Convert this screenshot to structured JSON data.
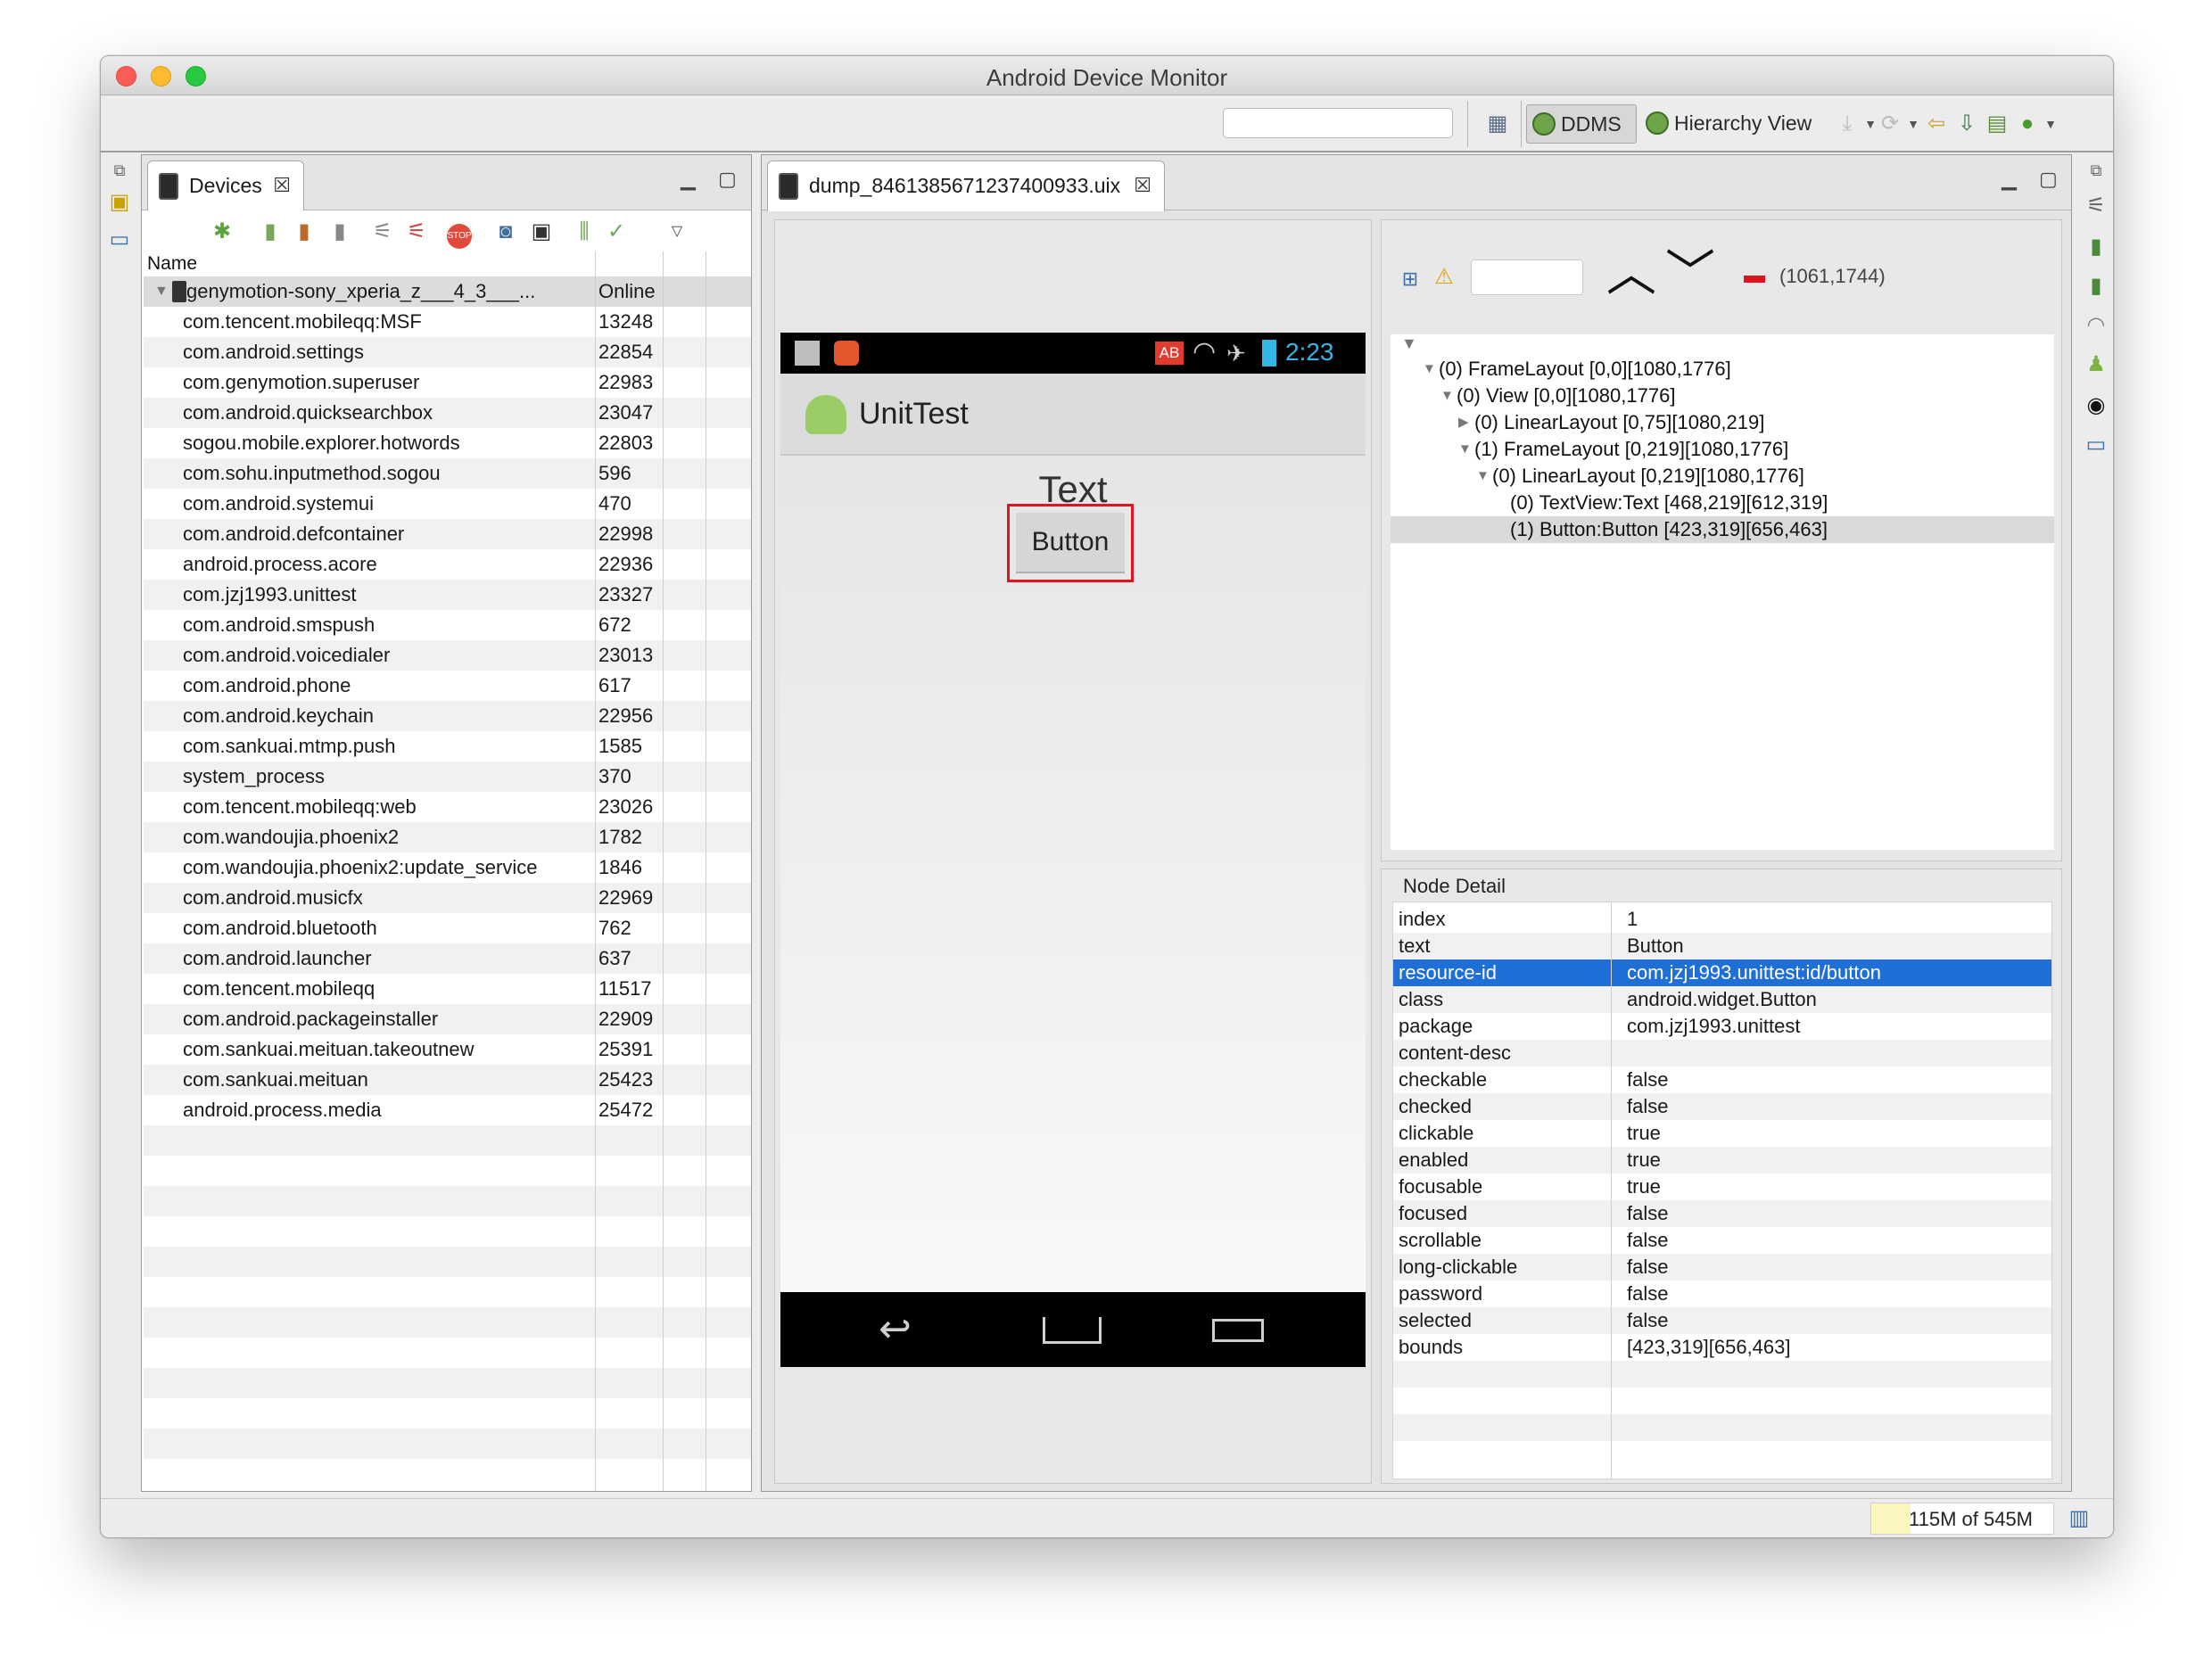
{
  "window": {
    "title": "Android Device Monitor"
  },
  "toolbar": {
    "quick_access_value": "",
    "perspectives": [
      {
        "label": "DDMS",
        "icon": "ddms-icon"
      },
      {
        "label": "Hierarchy View",
        "icon": "hierarchy-view-icon"
      }
    ]
  },
  "devices_view": {
    "tab_label": "Devices",
    "column_name": "Name",
    "device": {
      "name": "genymotion-sony_xperia_z___4_3___...",
      "status": "Online"
    },
    "processes": [
      {
        "name": "com.tencent.mobileqq:MSF",
        "pid": "13248"
      },
      {
        "name": "com.android.settings",
        "pid": "22854"
      },
      {
        "name": "com.genymotion.superuser",
        "pid": "22983"
      },
      {
        "name": "com.android.quicksearchbox",
        "pid": "23047"
      },
      {
        "name": "sogou.mobile.explorer.hotwords",
        "pid": "22803"
      },
      {
        "name": "com.sohu.inputmethod.sogou",
        "pid": "596"
      },
      {
        "name": "com.android.systemui",
        "pid": "470"
      },
      {
        "name": "com.android.defcontainer",
        "pid": "22998"
      },
      {
        "name": "android.process.acore",
        "pid": "22936"
      },
      {
        "name": "com.jzj1993.unittest",
        "pid": "23327"
      },
      {
        "name": "com.android.smspush",
        "pid": "672"
      },
      {
        "name": "com.android.voicedialer",
        "pid": "23013"
      },
      {
        "name": "com.android.phone",
        "pid": "617"
      },
      {
        "name": "com.android.keychain",
        "pid": "22956"
      },
      {
        "name": "com.sankuai.mtmp.push",
        "pid": "1585"
      },
      {
        "name": "system_process",
        "pid": "370"
      },
      {
        "name": "com.tencent.mobileqq:web",
        "pid": "23026"
      },
      {
        "name": "com.wandoujia.phoenix2",
        "pid": "1782"
      },
      {
        "name": "com.wandoujia.phoenix2:update_service",
        "pid": "1846"
      },
      {
        "name": "com.android.musicfx",
        "pid": "22969"
      },
      {
        "name": "com.android.bluetooth",
        "pid": "762"
      },
      {
        "name": "com.android.launcher",
        "pid": "637"
      },
      {
        "name": "com.tencent.mobileqq",
        "pid": "11517"
      },
      {
        "name": "com.android.packageinstaller",
        "pid": "22909"
      },
      {
        "name": "com.sankuai.meituan.takeoutnew",
        "pid": "25391"
      },
      {
        "name": "com.sankuai.meituan",
        "pid": "25423"
      },
      {
        "name": "android.process.media",
        "pid": "25472"
      }
    ]
  },
  "dump_view": {
    "tab_label": "dump_8461385671237400933.uix",
    "phone": {
      "status_time": "2:23",
      "status_badge": "AB",
      "action_bar_title": "UnitTest",
      "text_view": "Text",
      "button_label": "Button"
    },
    "search_value": "",
    "coords": "(1061,1744)",
    "tree": [
      {
        "label": "(0) FrameLayout [0,0][1080,1776]",
        "depth": 1,
        "toggle": "▼"
      },
      {
        "label": "(0) View [0,0][1080,1776]",
        "depth": 2,
        "toggle": "▼"
      },
      {
        "label": "(0) LinearLayout [0,75][1080,219]",
        "depth": 3,
        "toggle": "▶"
      },
      {
        "label": "(1) FrameLayout [0,219][1080,1776]",
        "depth": 3,
        "toggle": "▼"
      },
      {
        "label": "(0) LinearLayout [0,219][1080,1776]",
        "depth": 4,
        "toggle": "▼"
      },
      {
        "label": "(0) TextView:Text [468,219][612,319]",
        "depth": 5,
        "toggle": ""
      },
      {
        "label": "(1) Button:Button [423,319][656,463]",
        "depth": 5,
        "toggle": "",
        "selected": true
      }
    ],
    "node_detail_title": "Node Detail",
    "node_detail": [
      {
        "key": "index",
        "value": "1"
      },
      {
        "key": "text",
        "value": "Button"
      },
      {
        "key": "resource-id",
        "value": "com.jzj1993.unittest:id/button",
        "selected": true
      },
      {
        "key": "class",
        "value": "android.widget.Button"
      },
      {
        "key": "package",
        "value": "com.jzj1993.unittest"
      },
      {
        "key": "content-desc",
        "value": ""
      },
      {
        "key": "checkable",
        "value": "false"
      },
      {
        "key": "checked",
        "value": "false"
      },
      {
        "key": "clickable",
        "value": "true"
      },
      {
        "key": "enabled",
        "value": "true"
      },
      {
        "key": "focusable",
        "value": "true"
      },
      {
        "key": "focused",
        "value": "false"
      },
      {
        "key": "scrollable",
        "value": "false"
      },
      {
        "key": "long-clickable",
        "value": "false"
      },
      {
        "key": "password",
        "value": "false"
      },
      {
        "key": "selected",
        "value": "false"
      },
      {
        "key": "bounds",
        "value": "[423,319][656,463]"
      }
    ]
  },
  "status": {
    "heap": "115M of 545M"
  },
  "colors": {
    "selection": "#1f6fd6",
    "highlight_red": "#e0141e",
    "row_stripe": "#f1f1f1",
    "accent_blue": "#33b5e5"
  }
}
